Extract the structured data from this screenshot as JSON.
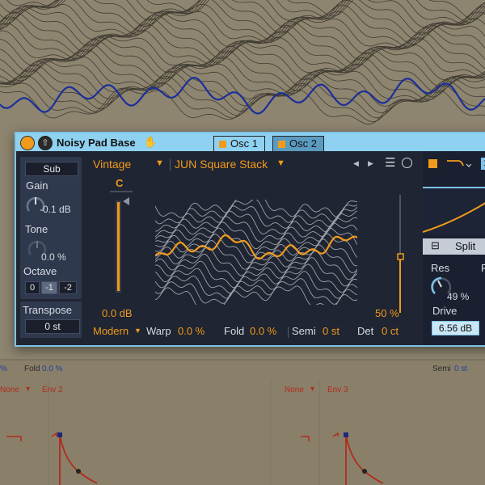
{
  "device": {
    "title": "Noisy Pad Base",
    "tabs": [
      "Osc 1",
      "Osc 2"
    ]
  },
  "left": {
    "sub": "Sub",
    "gain_label": "Gain",
    "gain_value": "-0.1 dB",
    "tone_label": "Tone",
    "tone_value": "0.0 %",
    "octave_label": "Octave",
    "octave_options": [
      "0",
      "-1",
      "-2"
    ],
    "transpose_label": "Transpose",
    "transpose_value": "0 st"
  },
  "osc": {
    "category": "Vintage",
    "wavetable": "JUN Square Stack",
    "pan_letter": "C",
    "level": "0.0 dB",
    "position": "50 %",
    "mode": "Modern",
    "warp_label": "Warp",
    "warp_value": "0.0 %",
    "fold_label": "Fold",
    "fold_value": "0.0 %",
    "semi_label": "Semi",
    "semi_value": "0 st",
    "det_label": "Det",
    "det_value": "0 ct",
    "nav_prev": "◀",
    "nav_next": "▶"
  },
  "filter": {
    "badge": "1",
    "split": "Split",
    "res_label": "Res",
    "res_value": "49 %",
    "drive_label": "Drive",
    "drive_value": "6.56 dB",
    "edge_letter": "F"
  },
  "background": {
    "warp_value": "%",
    "fold_label": "Fold",
    "fold_value": "0.0 %",
    "semi_label": "Semi",
    "semi_value": "0 st",
    "none_1": "None",
    "env_2": "Env 2",
    "none_2": "None",
    "env_3": "Env 3"
  },
  "colors": {
    "accent": "#f29a1c",
    "titlebar": "#8fd1f0",
    "panel": "#1f2532",
    "wave_active": "#f29a1c",
    "wave_lines": "#c9ccd4"
  }
}
